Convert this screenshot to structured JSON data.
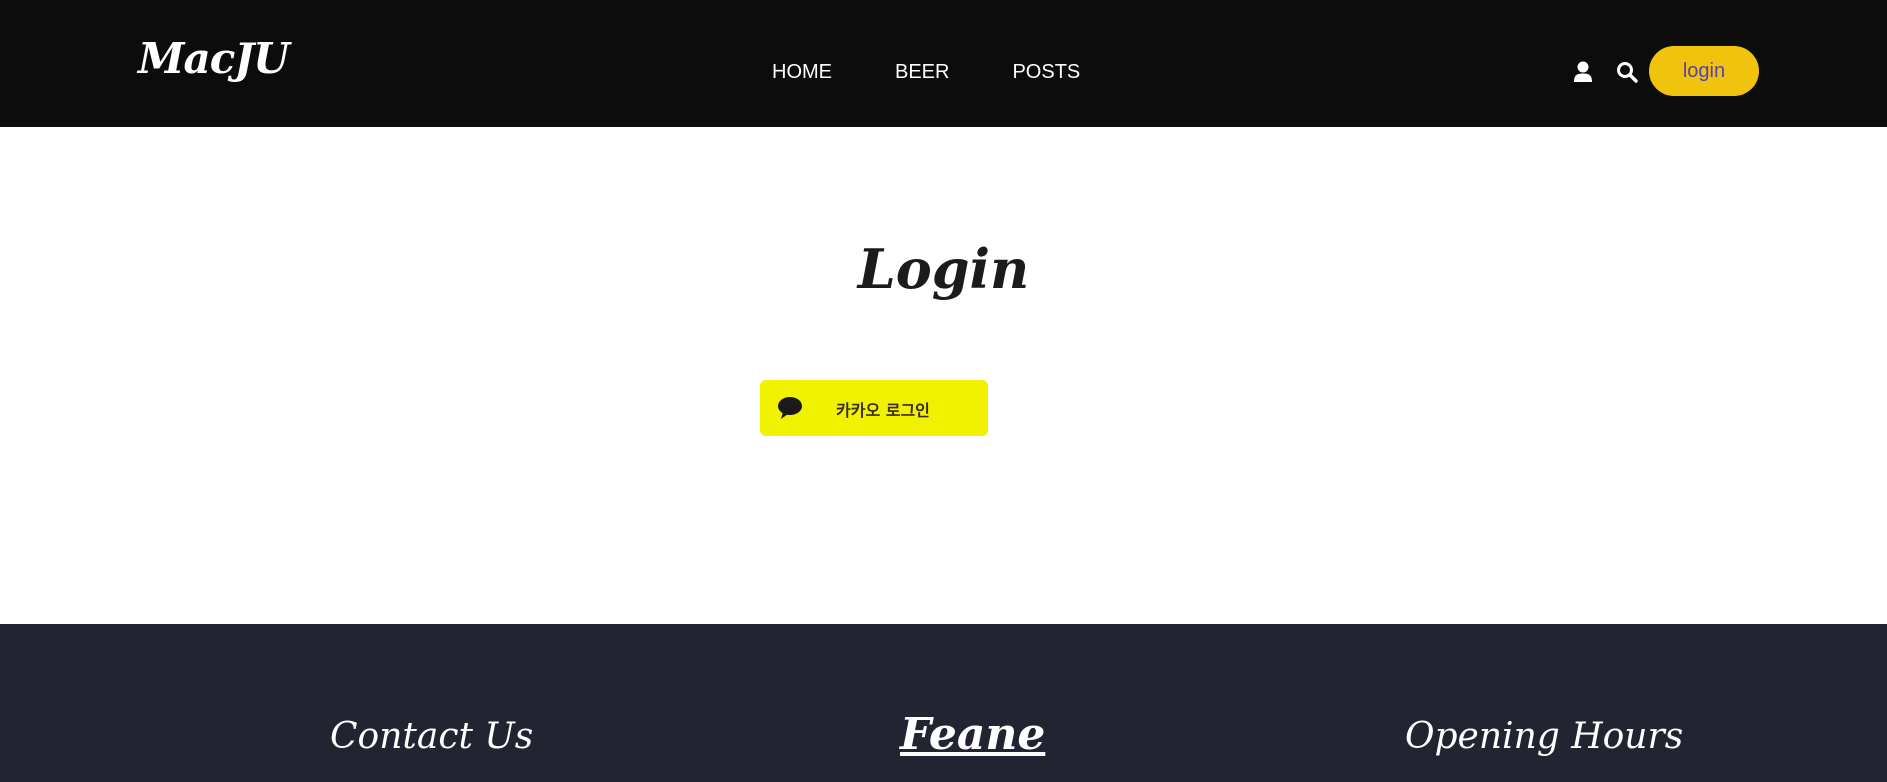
{
  "header": {
    "brand": "MacJU",
    "nav": [
      {
        "label": "HOME"
      },
      {
        "label": "BEER"
      },
      {
        "label": "POSTS"
      }
    ],
    "icons": {
      "user": "user-icon",
      "search": "search-icon"
    },
    "login_label": "login"
  },
  "main": {
    "title": "Login",
    "kakao_button": {
      "label": "카카오 로그인",
      "icon": "chat-bubble-icon"
    }
  },
  "footer": {
    "contact_heading": "Contact Us",
    "brand_heading": "Feane",
    "hours_heading": "Opening Hours"
  },
  "colors": {
    "header_bg": "#0c0c0d",
    "login_button_bg": "#f0c30c",
    "login_button_text": "#5a3fb0",
    "kakao_bg": "#f0f200",
    "footer_bg": "#222431"
  }
}
